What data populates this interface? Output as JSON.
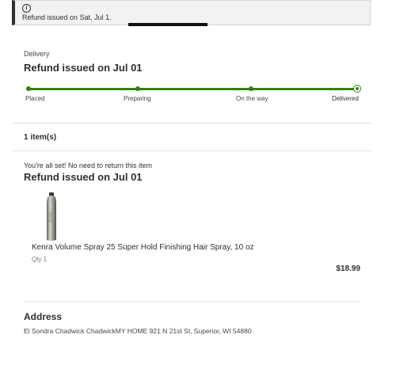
{
  "banner": {
    "icon": "info-icon",
    "text": "Refund issued on Sat, Jul 1."
  },
  "delivery": {
    "label": "Delivery",
    "title": "Refund issued on Jul 01",
    "steps": [
      "Placed",
      "Preparing",
      "On the way",
      "Delivered"
    ],
    "current_step": 4,
    "progress_color": "#2a8703"
  },
  "items": {
    "count_label": "1 item(s)",
    "status_note": "You're all set! No need to return this item",
    "title": "Refund issued on Jul 01",
    "product": {
      "name": "Kenra Volume Spray 25 Super Hold Finishing Hair Spray, 10 oz",
      "qty": "Qty 1",
      "price": "$18.99"
    }
  },
  "address": {
    "title": "Address",
    "text": "El Sondra Chadwick ChadwickMY HOME 921 N 21st St, Superior, WI 54880"
  }
}
